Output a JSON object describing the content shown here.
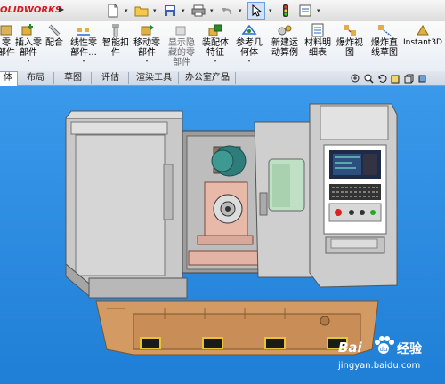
{
  "app": {
    "logo": "OLIDWORKS"
  },
  "ribbon": {
    "items": [
      {
        "label": "零\n部件",
        "icon": "part-icon"
      },
      {
        "label": "插入零\n部件",
        "icon": "insert-part-icon"
      },
      {
        "label": "配合",
        "icon": "mate-icon"
      },
      {
        "label": "线性零\n部件...",
        "icon": "linear-pattern-icon"
      },
      {
        "label": "智能扣\n件",
        "icon": "smart-fastener-icon"
      },
      {
        "label": "移动零\n部件",
        "icon": "move-part-icon"
      },
      {
        "label": "显示隐\n藏的零\n部件",
        "icon": "show-hidden-icon"
      },
      {
        "label": "装配体\n特征",
        "icon": "assembly-feature-icon"
      },
      {
        "label": "参考几\n何体",
        "icon": "reference-geometry-icon"
      },
      {
        "label": "新建运\n动算例",
        "icon": "motion-study-icon"
      },
      {
        "label": "材料明\n细表",
        "icon": "bom-icon"
      },
      {
        "label": "爆炸视\n图",
        "icon": "explode-view-icon"
      },
      {
        "label": "爆炸直\n线草图",
        "icon": "explode-line-icon"
      },
      {
        "label": "Instant3D",
        "icon": "instant3d-icon"
      }
    ]
  },
  "tabs": [
    "体",
    "布局",
    "草图",
    "评估",
    "渲染工具",
    "办公室产品"
  ],
  "watermark": {
    "brand": "Bai",
    "du": "du",
    "jingyan": "经验",
    "url": "jingyan.baidu.com"
  }
}
